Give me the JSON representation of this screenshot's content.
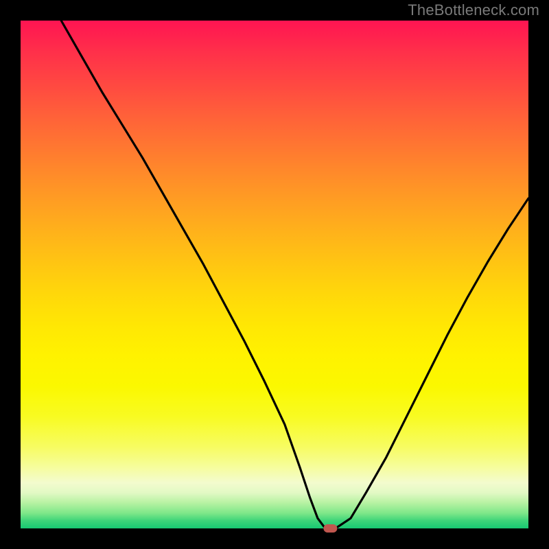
{
  "watermark": "TheBottleneck.com",
  "chart_data": {
    "type": "line",
    "title": "",
    "xlabel": "",
    "ylabel": "",
    "xlim": [
      0,
      100
    ],
    "ylim": [
      0,
      100
    ],
    "grid": false,
    "legend": false,
    "background": "rainbow-gradient-red-top-green-bottom",
    "series": [
      {
        "name": "bottleneck-curve",
        "x": [
          8,
          12,
          16,
          20,
          24,
          28,
          32,
          36,
          40,
          44,
          48,
          52,
          55,
          57,
          58.5,
          60,
          62,
          65,
          68,
          72,
          76,
          80,
          84,
          88,
          92,
          96,
          100
        ],
        "values": [
          100,
          93,
          86,
          79.5,
          73,
          66,
          59,
          52,
          44.5,
          37,
          29,
          20.5,
          12,
          6,
          2,
          0,
          0,
          2,
          7,
          14,
          22,
          30,
          38,
          45.5,
          52.5,
          59,
          65
        ]
      }
    ],
    "marker": {
      "name": "optimum-point",
      "x": 61,
      "y": 0,
      "color": "#c0574f"
    }
  },
  "colors": {
    "frame": "#000000",
    "curve": "#000000",
    "marker": "#c0574f",
    "watermark": "#7a7a7a"
  }
}
